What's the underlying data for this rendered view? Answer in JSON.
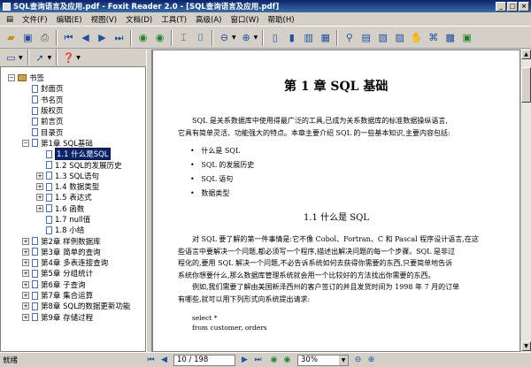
{
  "window": {
    "title": "SQL查询语言及应用.pdf - Foxit Reader 2.0 - [SQL查询语言及应用.pdf]"
  },
  "menu": [
    "文件(F)",
    "编辑(E)",
    "视图(V)",
    "文档(D)",
    "工具(T)",
    "高级(A)",
    "窗口(W)",
    "帮助(H)"
  ],
  "bookmarks": {
    "root": "书签",
    "items": [
      "封面页",
      "书名页",
      "版权页",
      "前言页",
      "目录页"
    ],
    "chapter1": "第1章 SQL基础",
    "chapter1_items": [
      "1.1 什么是SQL",
      "1.2 SQL的发展历史",
      "1.3 SQL语句",
      "1.4 数据类型",
      "1.5 表达式",
      "1.6 函数",
      "1.7 null值",
      "1.8 小结"
    ],
    "chapters": [
      "第2章 样例数据库",
      "第3章 简单的查询",
      "第4章 多表连接查询",
      "第5章 分组统计",
      "第6章 子查询",
      "第7章 集合运算",
      "第8章 SQL的数据更新功能",
      "第9章 存储过程"
    ]
  },
  "doc": {
    "chapter_title": "第 1 章   SQL 基础",
    "intro_line1": "SQL 是关系数据库中使用得最广泛的工具,已成为关系数据库的标准数据操纵语言,",
    "intro_line2": "它具有简单灵活、功能强大的特点。本章主要介绍 SQL 的一些基本知识,主要内容包括:",
    "bullets": [
      "什么是 SQL",
      "SQL 的发展历史",
      "SQL 语句",
      "数据类型"
    ],
    "section_title": "1.1   什么是 SQL",
    "para1": [
      "对 SQL 要了解的第一件事情是:它不像 Cobol、Fortran、C 和 Pascal 程序设计语言,在这",
      "些语言中要解决一个问题,都必须写一个程序,描述出解决问题的每一个步骤。SQL 是非过",
      "程化的,要用 SQL 解决一个问题,不必告诉系统如何去获得你需要的东西,只要简单地告诉",
      "系统你想要什么,那么数据库管理系统就会用一个比较好的方法找出你需要的东西。"
    ],
    "para2": [
      "例如,我们需要了解由美国新泽西州的客户签订的并且发货时间为 1998 年 7 月的订单",
      "有哪些,就可以用下列形式向系统提出请求:"
    ],
    "code": [
      "select *",
      "from customer, orders"
    ]
  },
  "status": {
    "ready": "就绪",
    "page": "10 / 198",
    "zoom": "30%"
  }
}
